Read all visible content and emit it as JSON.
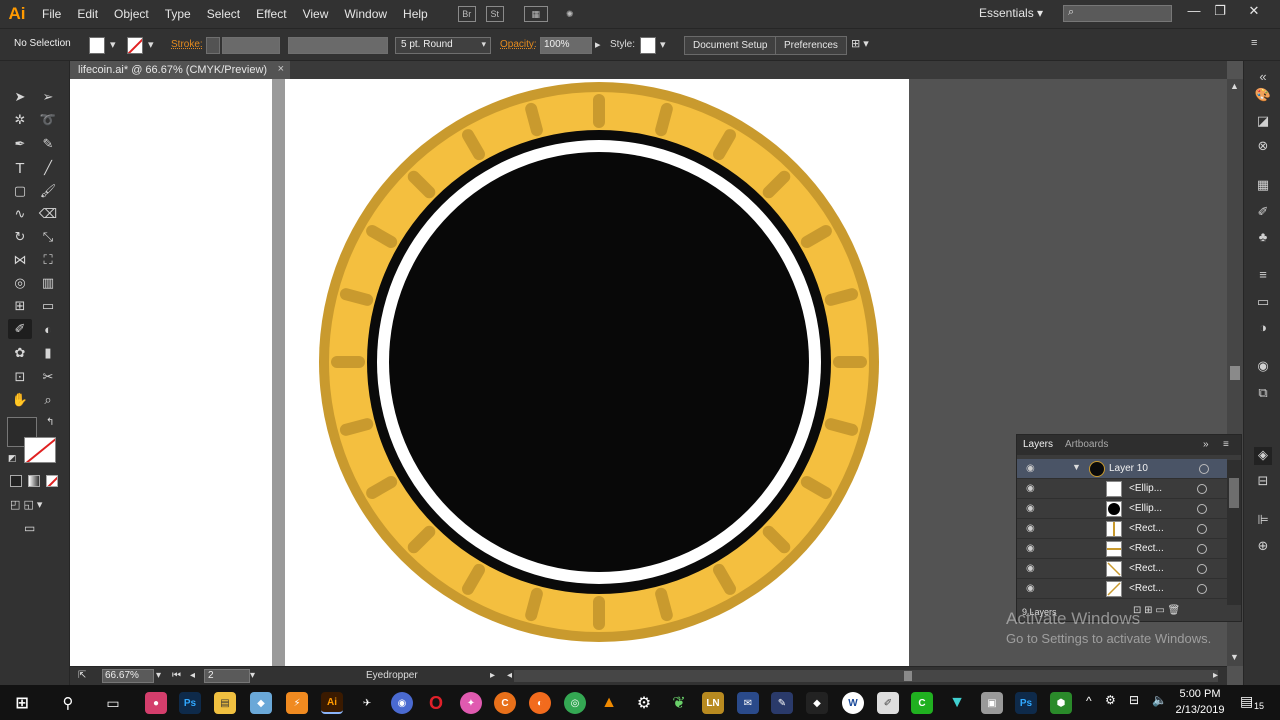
{
  "app": {
    "logo": "Ai",
    "menu": [
      "File",
      "Edit",
      "Object",
      "Type",
      "Select",
      "Effect",
      "View",
      "Window",
      "Help"
    ],
    "menubar_icons": [
      "Br",
      "St"
    ],
    "workspace": "Essentials",
    "window_controls": [
      "minimize",
      "restore",
      "close"
    ]
  },
  "controlbar": {
    "selection_status": "No Selection",
    "stroke_label": "Stroke:",
    "brush_label": "5 pt. Round",
    "opacity_label": "Opacity:",
    "opacity_value": "100%",
    "style_label": "Style:",
    "document_setup": "Document Setup",
    "preferences": "Preferences"
  },
  "document": {
    "tab_title": "lifecoin.ai* @ 66.67% (CMYK/Preview)",
    "close_glyph": "×"
  },
  "tools": [
    "selection-tool",
    "direct-selection-tool",
    "magic-wand-tool",
    "lasso-tool",
    "pen-tool",
    "curvature-tool",
    "type-tool",
    "line-segment-tool",
    "rectangle-tool",
    "paintbrush-tool",
    "shaper-tool",
    "eraser-tool",
    "rotate-tool",
    "scale-tool",
    "width-tool",
    "free-transform-tool",
    "shape-builder-tool",
    "perspective-grid-tool",
    "mesh-tool",
    "gradient-tool",
    "eyedropper-tool",
    "blend-tool",
    "symbol-sprayer-tool",
    "column-graph-tool",
    "artboard-tool",
    "slice-tool",
    "hand-tool",
    "zoom-tool"
  ],
  "colors": {
    "coin_outer": "#c99a2e",
    "coin_inner": "#f4bf3f",
    "coin_ticks": "#c99a2e",
    "ring_black": "#0a0a0a",
    "ring_white": "#ffffff",
    "core": "#080808",
    "fill_swatch": "#2b2b2b",
    "app_orange": "#ff9a00"
  },
  "coin": {
    "tick_count": 24
  },
  "layers_panel": {
    "tabs": [
      "Layers",
      "Artboards"
    ],
    "layers": [
      {
        "name": "Layer 10",
        "thumb": "coin"
      },
      {
        "name": "<Ellip...",
        "thumb": "white"
      },
      {
        "name": "<Ellip...",
        "thumb": "black-circle"
      },
      {
        "name": "<Rect...",
        "thumb": "white-bar"
      },
      {
        "name": "<Rect...",
        "thumb": "white"
      },
      {
        "name": "<Rect...",
        "thumb": "diagonal"
      },
      {
        "name": "<Rect...",
        "thumb": "diagonal"
      }
    ],
    "count_label": "9 Layers"
  },
  "statusbar": {
    "zoom": "66.67%",
    "artboard_index": "2",
    "current_tool": "Eyedropper"
  },
  "watermark": {
    "title": "Activate Windows",
    "subtitle": "Go to Settings to activate Windows."
  },
  "taskbar": {
    "time": "5:00 PM",
    "date": "2/13/2019",
    "notification_count": "15",
    "apps": [
      "start",
      "search",
      "task-view",
      "app-1",
      "photoshop",
      "file-explorer",
      "app-4",
      "app-5",
      "illustrator",
      "app-7",
      "app-8",
      "opera",
      "app-10",
      "ccleaner",
      "firefox",
      "chrome",
      "vlc",
      "settings",
      "app-16",
      "libreoffice",
      "app-18",
      "app-19",
      "app-20",
      "app-21",
      "app-22",
      "app-23",
      "app-24",
      "app-25",
      "photoshop-2",
      "app-27"
    ]
  }
}
